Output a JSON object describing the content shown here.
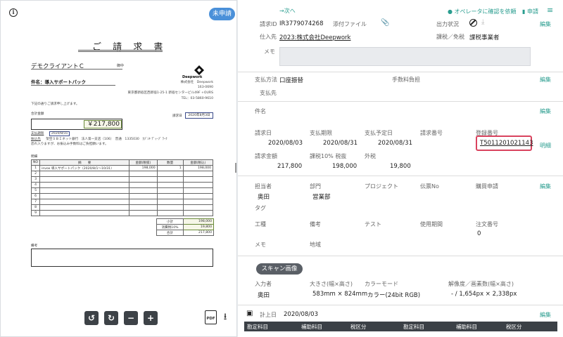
{
  "left": {
    "status_badge": "未申請",
    "invoice": {
      "title": "ご 請 求 書",
      "client": "デモクライアントＣ",
      "client_honorific": "御中",
      "subject": "件名：導入サポートパック",
      "logo_text": "Deepwork",
      "issuer_company": "株式会社　Deepwork",
      "issuer_zip": "163-0690",
      "issuer_address": "東京都新宿区西新宿1-25-1 新宿センタービル49F +OURS",
      "issuer_tel": "TEL：03-5860-9610",
      "intro": "下記の通りご請求申し上げます。",
      "amount_label": "合計金額",
      "amount": "￥217,800",
      "date_label": "請求日",
      "date": "2020年8月3日",
      "due_label": "支払期限",
      "due_value": "2020/8/31",
      "bank_label": "振込先",
      "bank_value": "架空ＳＢＩネット銀行　法人第一支店（106）　普通　1335030　ｶﾌﾞｼｷ ﾃﾞｨｰﾌﾟ ﾜｰｸ",
      "fee_note": "恐れ入りますが、お振込み手数料はご負担願います。",
      "detail_label": "明細",
      "columns": [
        "NO",
        "摘　　要",
        "金額(税抜)",
        "数量",
        "金額(税込)"
      ],
      "rows": [
        [
          "1",
          "invox 導入サポートパック（2020/8/1～10/31）",
          "198,000",
          "1",
          "198,000"
        ],
        [
          "2",
          "",
          "",
          "",
          ""
        ],
        [
          "3",
          "",
          "",
          "",
          ""
        ],
        [
          "4",
          "",
          "",
          "",
          ""
        ],
        [
          "5",
          "",
          "",
          "",
          ""
        ],
        [
          "6",
          "",
          "",
          "",
          ""
        ],
        [
          "7",
          "",
          "",
          "",
          ""
        ],
        [
          "8",
          "",
          "",
          "",
          ""
        ],
        [
          "9",
          "",
          "",
          "",
          ""
        ]
      ],
      "totals": [
        [
          "小計",
          "198,000"
        ],
        [
          "消費税10%",
          "19,800"
        ],
        [
          "合計",
          "217,800"
        ]
      ],
      "note_label": "備考"
    },
    "toolbar": {
      "rotate_left": "↺",
      "rotate_right": "↻",
      "zoom_out": "−",
      "zoom_in": "+",
      "pdf": "PDF",
      "download": "⭳"
    }
  },
  "right": {
    "top_bar": {
      "next": "→次へ",
      "confirm_operator": "オペレータに確認を依頼",
      "apply": "申請",
      "menu": "≡"
    },
    "edit_label": "編集",
    "detail_label": "明細",
    "basic": {
      "invoice_id_label": "請求ID",
      "invoice_id": "IR3779074268",
      "attachment_label": "添付ファイル",
      "output_status_label": "出力状況",
      "vendor_label": "仕入先",
      "vendor": "2023:株式会社Deepwork",
      "tax_label": "課税／免税",
      "tax_value": "課税事業者",
      "memo_label": "メモ"
    },
    "payment": {
      "method_label": "支払方法",
      "method": "口座振替",
      "fee_label": "手数料負担",
      "payee_label": "支払先"
    },
    "subject_label": "件名",
    "amounts": {
      "invoice_date_label": "請求日",
      "invoice_date": "2020/08/03",
      "due_label": "支払期限",
      "due": "2020/08/31",
      "planned_label": "支払予定日",
      "planned": "2020/08/31",
      "number_label": "請求番号",
      "reg_label": "登録番号",
      "reg_value": "T5011201021143",
      "total_label": "請求金額",
      "total": "217,800",
      "tax10_label": "課税10% 税抜",
      "tax10": "198,000",
      "tax_label": "税",
      "tax": "19,800",
      "exempt_label": "外税"
    },
    "assign": {
      "owner_label": "担当者",
      "owner": "奥田",
      "dept_label": "部門",
      "dept": "営業部",
      "project_label": "プロジェクト",
      "slip_label": "伝票No",
      "purchase_label": "購買申請",
      "tag_label": "タグ",
      "work_label": "工種",
      "remarks_label": "備考",
      "test_label": "テスト",
      "period_label": "使用期間",
      "order_label": "注文番号",
      "order_value": "0",
      "memo_label": "メモ",
      "region_label": "地域"
    },
    "scan": {
      "pill": "スキャン画像",
      "input_label": "入力者",
      "input": "奥田",
      "size_label": "大きさ(幅×高さ)",
      "size": "583mm × 824mm",
      "color_label": "カラーモード",
      "color": "カラー(24bit RGB)",
      "res_label": "解像度／画素数(幅×高さ)",
      "res": "- / 1,654px × 2,338px"
    },
    "journal": {
      "date_label": "計上日",
      "date": "2020/08/03",
      "headers": [
        "勘定科目",
        "補助科目",
        "税区分",
        "勘定科目",
        "補助科目",
        "税区分"
      ]
    }
  }
}
